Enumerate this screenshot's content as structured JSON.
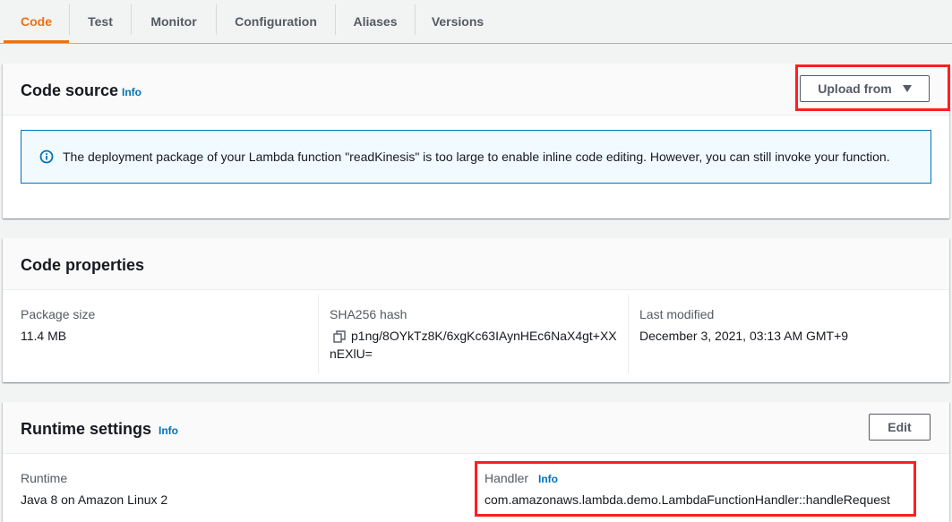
{
  "tabs": [
    {
      "label": "Code",
      "active": true
    },
    {
      "label": "Test",
      "active": false
    },
    {
      "label": "Monitor",
      "active": false
    },
    {
      "label": "Configuration",
      "active": false
    },
    {
      "label": "Aliases",
      "active": false
    },
    {
      "label": "Versions",
      "active": false
    }
  ],
  "code_source": {
    "title": "Code source",
    "info": "Info",
    "upload_button": "Upload from",
    "alert_text": "The deployment package of your Lambda function \"readKinesis\" is too large to enable inline code editing. However, you can still invoke your function."
  },
  "code_properties": {
    "title": "Code properties",
    "package_size_label": "Package size",
    "package_size_value": "11.4 MB",
    "sha_label": "SHA256 hash",
    "sha_line1": "p1ng/8OYkTz8K/6xgKc63IAynHEc6NaX4gt+XX",
    "sha_line2": "nEXlU=",
    "last_modified_label": "Last modified",
    "last_modified_value": "December 3, 2021, 03:13 AM GMT+9"
  },
  "runtime_settings": {
    "title": "Runtime settings",
    "info": "Info",
    "edit_button": "Edit",
    "runtime_label": "Runtime",
    "runtime_value": "Java 8 on Amazon Linux 2",
    "handler_label": "Handler",
    "handler_info": "Info",
    "handler_value": "com.amazonaws.lambda.demo.LambdaFunctionHandler::handleRequest"
  },
  "icons": {
    "info_circle": "info-circle-icon",
    "copy": "copy-icon",
    "caret": "caret-down-icon"
  },
  "colors": {
    "accent": "#ec7211",
    "link": "#0073bb",
    "highlight": "#ff1f1f",
    "alert_bg": "#f1faff"
  }
}
